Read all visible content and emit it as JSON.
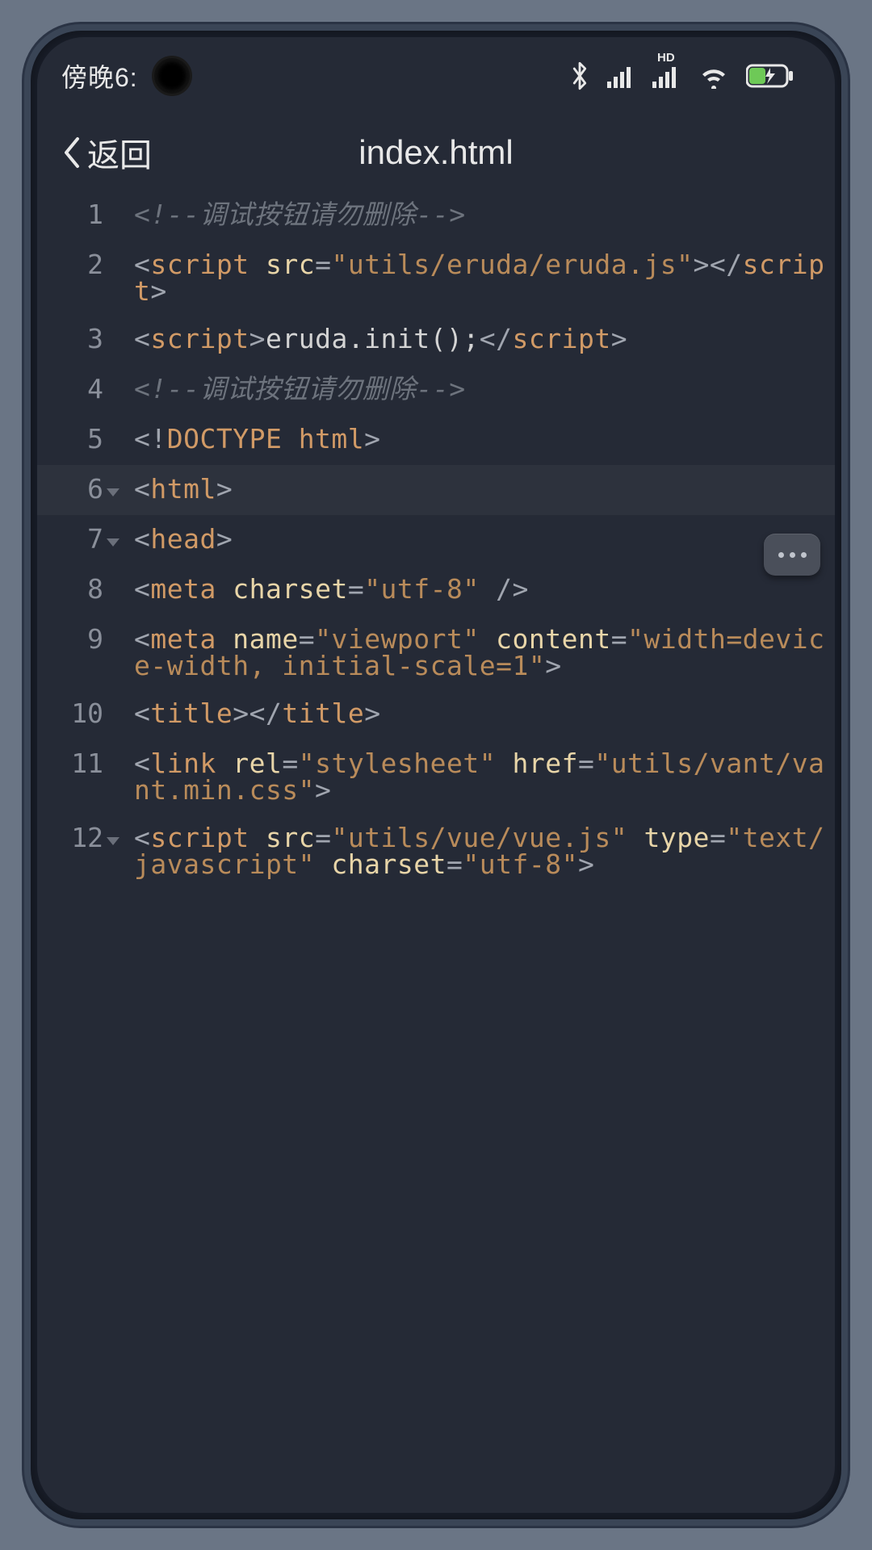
{
  "status": {
    "time_label": "傍晚6:",
    "icons": [
      "bluetooth",
      "signal",
      "hd-signal",
      "wifi",
      "battery-charging"
    ]
  },
  "header": {
    "back_label": "返回",
    "title": "index.html"
  },
  "lines": [
    {
      "num": "1",
      "fold": false,
      "highlight": false,
      "tokens": [
        {
          "t": "comment",
          "v": "<!--调试按钮请勿删除-->"
        }
      ]
    },
    {
      "num": "2",
      "fold": false,
      "highlight": false,
      "tokens": [
        {
          "t": "punct",
          "v": "<"
        },
        {
          "t": "tag",
          "v": "script"
        },
        {
          "t": "text",
          "v": " "
        },
        {
          "t": "attr",
          "v": "src"
        },
        {
          "t": "punct",
          "v": "="
        },
        {
          "t": "string",
          "v": "\"utils/eruda/eruda.js\""
        },
        {
          "t": "punct",
          "v": ">"
        },
        {
          "t": "punct",
          "v": "</"
        },
        {
          "t": "tag",
          "v": "script"
        },
        {
          "t": "punct",
          "v": ">"
        }
      ],
      "wrap_after": 7
    },
    {
      "num": "3",
      "fold": false,
      "highlight": false,
      "tokens": [
        {
          "t": "punct",
          "v": "<"
        },
        {
          "t": "tag",
          "v": "script"
        },
        {
          "t": "punct",
          "v": ">"
        },
        {
          "t": "text",
          "v": "eruda.init();"
        },
        {
          "t": "punct",
          "v": "</"
        },
        {
          "t": "tag",
          "v": "script"
        },
        {
          "t": "punct",
          "v": ">"
        }
      ]
    },
    {
      "num": "4",
      "fold": false,
      "highlight": false,
      "tokens": [
        {
          "t": "comment",
          "v": "<!--调试按钮请勿删除-->"
        }
      ]
    },
    {
      "num": "5",
      "fold": false,
      "highlight": false,
      "tokens": [
        {
          "t": "punct",
          "v": "<!"
        },
        {
          "t": "tag",
          "v": "DOCTYPE html"
        },
        {
          "t": "punct",
          "v": ">"
        }
      ]
    },
    {
      "num": "6",
      "fold": true,
      "highlight": true,
      "tokens": [
        {
          "t": "punct",
          "v": "<"
        },
        {
          "t": "tag",
          "v": "html"
        },
        {
          "t": "punct",
          "v": ">"
        }
      ]
    },
    {
      "num": "7",
      "fold": true,
      "highlight": false,
      "tokens": [
        {
          "t": "punct",
          "v": "<"
        },
        {
          "t": "tag",
          "v": "head"
        },
        {
          "t": "punct",
          "v": ">"
        }
      ]
    },
    {
      "num": "8",
      "fold": false,
      "highlight": false,
      "tokens": [
        {
          "t": "punct",
          "v": "<"
        },
        {
          "t": "tag",
          "v": "meta"
        },
        {
          "t": "text",
          "v": " "
        },
        {
          "t": "attr",
          "v": "charset"
        },
        {
          "t": "punct",
          "v": "="
        },
        {
          "t": "string",
          "v": "\"utf-8\""
        },
        {
          "t": "text",
          "v": " "
        },
        {
          "t": "punct",
          "v": "/>"
        }
      ]
    },
    {
      "num": "9",
      "fold": false,
      "highlight": false,
      "tokens": [
        {
          "t": "punct",
          "v": "<"
        },
        {
          "t": "tag",
          "v": "meta"
        },
        {
          "t": "text",
          "v": " "
        },
        {
          "t": "attr",
          "v": "name"
        },
        {
          "t": "punct",
          "v": "="
        },
        {
          "t": "string",
          "v": "\"viewport\""
        },
        {
          "t": "text",
          "v": " "
        },
        {
          "t": "attr",
          "v": "content"
        },
        {
          "t": "punct",
          "v": "="
        },
        {
          "t": "string",
          "v": "\"width=device-width, initial-scale=1\""
        },
        {
          "t": "punct",
          "v": ">"
        }
      ]
    },
    {
      "num": "10",
      "fold": false,
      "highlight": false,
      "tokens": [
        {
          "t": "punct",
          "v": "<"
        },
        {
          "t": "tag",
          "v": "title"
        },
        {
          "t": "punct",
          "v": ">"
        },
        {
          "t": "punct",
          "v": "</"
        },
        {
          "t": "tag",
          "v": "title"
        },
        {
          "t": "punct",
          "v": ">"
        }
      ]
    },
    {
      "num": "11",
      "fold": false,
      "highlight": false,
      "tokens": [
        {
          "t": "punct",
          "v": "<"
        },
        {
          "t": "tag",
          "v": "link"
        },
        {
          "t": "text",
          "v": " "
        },
        {
          "t": "attr",
          "v": "rel"
        },
        {
          "t": "punct",
          "v": "="
        },
        {
          "t": "string",
          "v": "\"stylesheet\""
        },
        {
          "t": "text",
          "v": " "
        },
        {
          "t": "attr",
          "v": "href"
        },
        {
          "t": "punct",
          "v": "="
        },
        {
          "t": "string",
          "v": "\"utils/vant/vant.min.css\""
        },
        {
          "t": "punct",
          "v": ">"
        }
      ]
    },
    {
      "num": "12",
      "fold": true,
      "highlight": false,
      "tokens": [
        {
          "t": "punct",
          "v": "<"
        },
        {
          "t": "tag",
          "v": "script"
        },
        {
          "t": "text",
          "v": " "
        },
        {
          "t": "attr",
          "v": "src"
        },
        {
          "t": "punct",
          "v": "="
        },
        {
          "t": "string",
          "v": "\"utils/vue/vue.js\""
        },
        {
          "t": "text",
          "v": " "
        },
        {
          "t": "attr",
          "v": "type"
        },
        {
          "t": "punct",
          "v": "="
        },
        {
          "t": "string",
          "v": "\"text/javascript\""
        },
        {
          "t": "text",
          "v": " "
        },
        {
          "t": "attr",
          "v": "charset"
        },
        {
          "t": "punct",
          "v": "="
        },
        {
          "t": "string",
          "v": "\"utf-8\""
        },
        {
          "t": "punct",
          "v": ">"
        }
      ]
    }
  ]
}
